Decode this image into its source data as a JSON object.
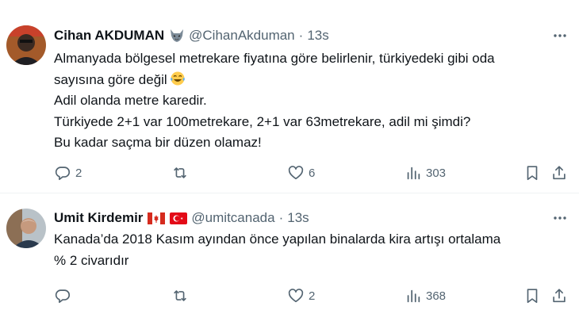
{
  "tweets": [
    {
      "author": {
        "name": "Cihan AKDUMAN",
        "handle": "@CihanAkduman",
        "time": "13s",
        "badge_icon": "wolf-emoji-icon"
      },
      "lines": [
        "Almanyada bölgesel metrekare fiyatına göre belirlenir, türkiyedeki gibi oda",
        "sayısına göre değil",
        "Adil olanda metre karedir.",
        "Türkiyede 2+1 var 100metrekare, 2+1 var 63metrekare, adil mi şimdi?",
        "Bu kadar saçma bir düzen olamaz!"
      ],
      "emoji_icon": "tears-of-joy-emoji-icon",
      "stats": {
        "replies": "2",
        "retweets": "",
        "likes": "6",
        "views": "303"
      }
    },
    {
      "author": {
        "name": "Umit Kirdemir",
        "handle": "@umitcanada",
        "time": "13s",
        "flags": [
          "canada-flag-icon",
          "turkey-flag-icon"
        ]
      },
      "lines": [
        "Kanada’da 2018 Kasım ayından önce yapılan binalarda kira artışı ortalama",
        "% 2 civarıdır"
      ],
      "stats": {
        "replies": "",
        "retweets": "",
        "likes": "2",
        "views": "368"
      }
    }
  ],
  "colors": {
    "text": "#0f1419",
    "muted": "#536471",
    "divider": "#eff3f4"
  },
  "dot_separator": "·"
}
